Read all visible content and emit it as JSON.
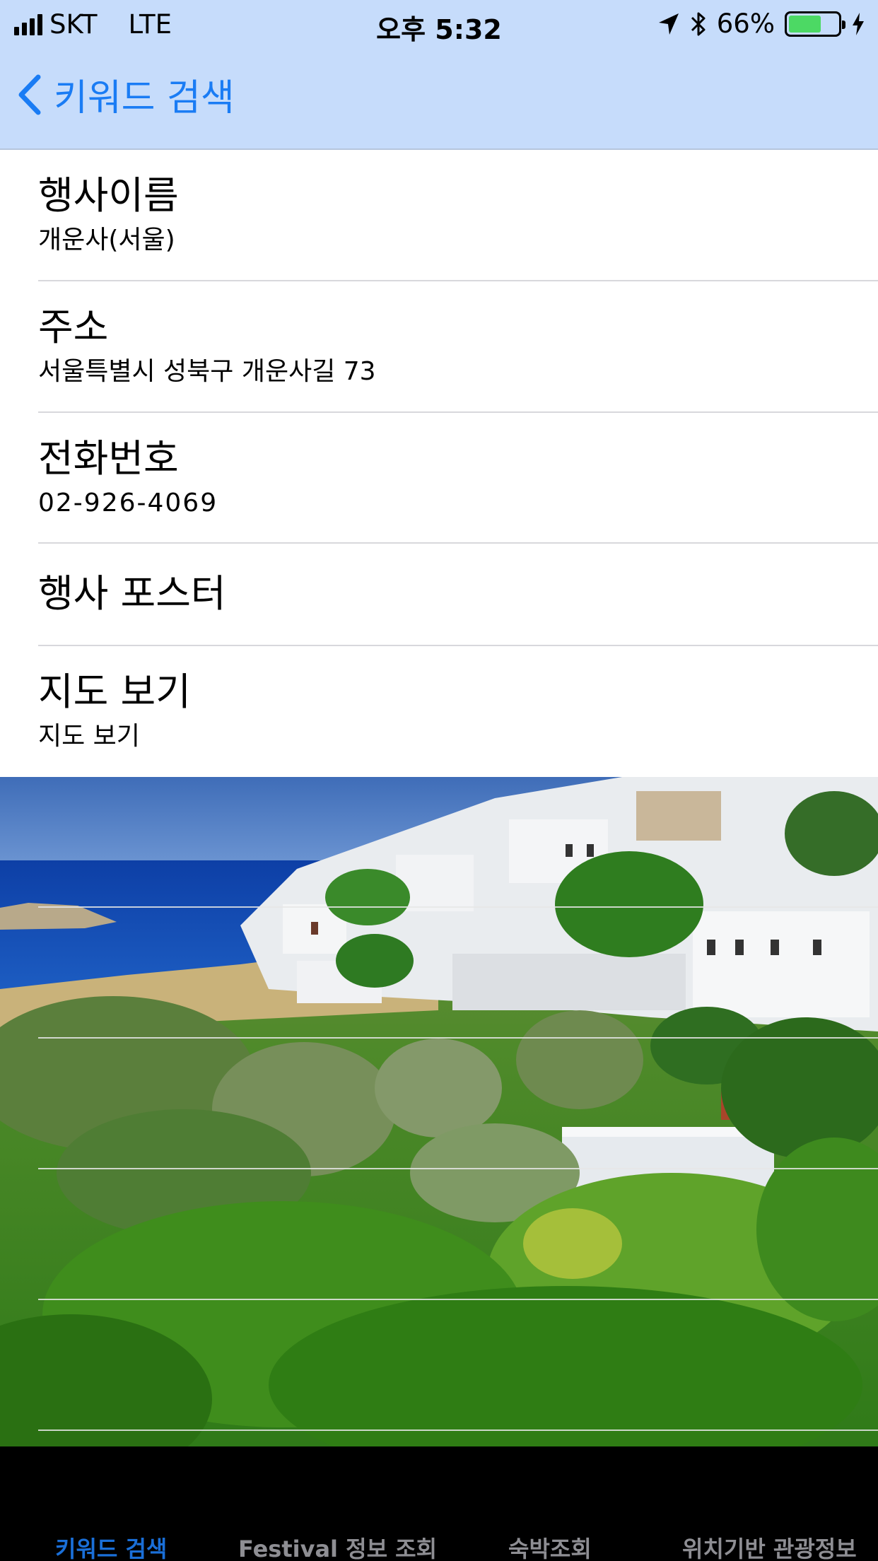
{
  "status_bar": {
    "carrier": "SKT",
    "network": "LTE",
    "time": "오후 5:32",
    "battery_percent": "66%",
    "battery_level": 0.66,
    "battery_color": "#4cd964",
    "icons": [
      "signal-bars-icon",
      "location-arrow-icon",
      "bluetooth-icon",
      "battery-icon",
      "charging-bolt-icon"
    ]
  },
  "nav_bar": {
    "back_label": "키워드 검색",
    "back_icon": "chevron-left-icon",
    "background": "#c6dcfb",
    "tint": "#1a7cf4"
  },
  "details": {
    "event_name": {
      "title": "행사이름",
      "value": "개운사(서울)"
    },
    "address": {
      "title": "주소",
      "value": "서울특별시 성북구 개운사길 73"
    },
    "phone": {
      "title": "전화번호",
      "value": "02-926-4069"
    },
    "poster": {
      "title": "행사 포스터"
    },
    "map": {
      "title": "지도 보기",
      "value": "지도 보기"
    }
  },
  "tabs": [
    {
      "label": "키워드 검색",
      "active": true
    },
    {
      "label": "Festival 정보 조회",
      "active": false
    },
    {
      "label": "숙박조회",
      "active": false
    },
    {
      "label": "위치기반 관광정보",
      "active": false
    }
  ]
}
